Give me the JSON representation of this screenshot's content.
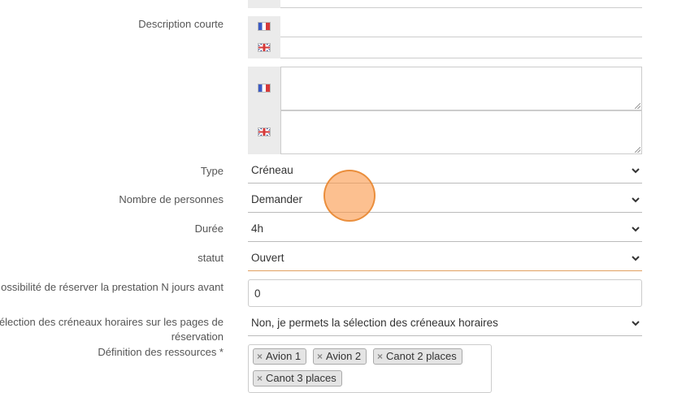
{
  "form": {
    "short_description": {
      "label": "Description courte"
    },
    "type": {
      "label": "Type",
      "value": "Créneau"
    },
    "persons": {
      "label": "Nombre de personnes",
      "value": "Demander"
    },
    "duration": {
      "label": "Durée",
      "value": "4h"
    },
    "status": {
      "label": "statut",
      "value": "Ouvert"
    },
    "days_before": {
      "label": "ossibilité de réserver la prestation N jours avant",
      "value": "0"
    },
    "slot_selection": {
      "label": "élection des créneaux horaires sur les pages de réservation",
      "value": "Non, je permets la sélection des créneaux horaires"
    },
    "resources": {
      "label": "Définition des ressources *",
      "tags": [
        "Avion 1",
        "Avion 2",
        "Canot 2 places",
        "Canot 3 places"
      ],
      "remove_glyph": "×"
    }
  },
  "icons": {
    "fr": "flag-fr-icon",
    "uk": "flag-uk-icon",
    "chevron": "chevron-down-icon"
  },
  "colors": {
    "active_underline": "#e0a060",
    "cursor": "#f59a4a",
    "flag_cell": "#ebebeb"
  }
}
